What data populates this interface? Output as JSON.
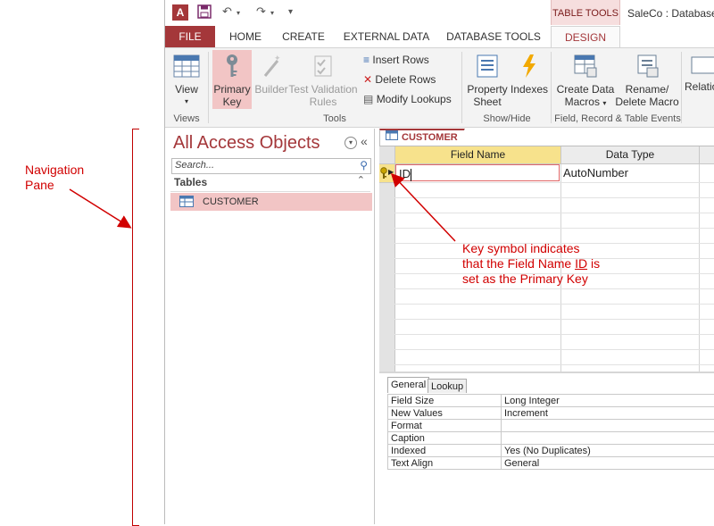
{
  "annotations": {
    "navigation_pane": "Navigation\nPane",
    "key_note": "Key symbol indicates\nthat the Field Name ID is\nset as the Primary Key",
    "key_note_lines": [
      "Key symbol indicates",
      "that the Field Name ",
      "ID",
      " is",
      "set as the Primary Key"
    ]
  },
  "titlebar": {
    "app_icon_letter": "A",
    "context_tab": "TABLE TOOLS",
    "document_title": "SaleCo : Database- C"
  },
  "ribbon_tabs": [
    "FILE",
    "HOME",
    "CREATE",
    "EXTERNAL DATA",
    "DATABASE TOOLS",
    "DESIGN"
  ],
  "ribbon": {
    "view": "View",
    "primary_key": [
      "Primary",
      "Key"
    ],
    "builder": "Builder",
    "test_validation": [
      "Test Validation",
      "Rules"
    ],
    "insert_rows": "Insert Rows",
    "delete_rows": "Delete Rows",
    "modify_lookups": "Modify Lookups",
    "property_sheet": [
      "Property",
      "Sheet"
    ],
    "indexes": "Indexes",
    "create_data_macros": [
      "Create Data",
      "Macros"
    ],
    "rename_delete_macro": [
      "Rename/",
      "Delete Macro"
    ],
    "relationships": "Relatio",
    "groups": {
      "views": "Views",
      "tools": "Tools",
      "show_hide": "Show/Hide",
      "field_record_events": "Field, Record & Table Events"
    }
  },
  "nav": {
    "title": "All Access Objects",
    "search_placeholder": "Search...",
    "section": "Tables",
    "items": [
      {
        "label": "CUSTOMER"
      }
    ]
  },
  "document": {
    "tab_label": "CUSTOMER",
    "columns": [
      "Field Name",
      "Data Type"
    ],
    "rows": [
      {
        "field_name": "ID",
        "data_type": "AutoNumber",
        "primary_key": true
      }
    ]
  },
  "properties": {
    "tabs": [
      "General",
      "Lookup"
    ],
    "rows": [
      {
        "name": "Field Size",
        "value": "Long Integer"
      },
      {
        "name": "New Values",
        "value": "Increment"
      },
      {
        "name": "Format",
        "value": ""
      },
      {
        "name": "Caption",
        "value": ""
      },
      {
        "name": "Indexed",
        "value": "Yes (No Duplicates)"
      },
      {
        "name": "Text Align",
        "value": "General"
      }
    ]
  },
  "colors": {
    "accent": "#a4373a",
    "annotation": "#d10000",
    "key_highlight": "#f2c5c5"
  }
}
